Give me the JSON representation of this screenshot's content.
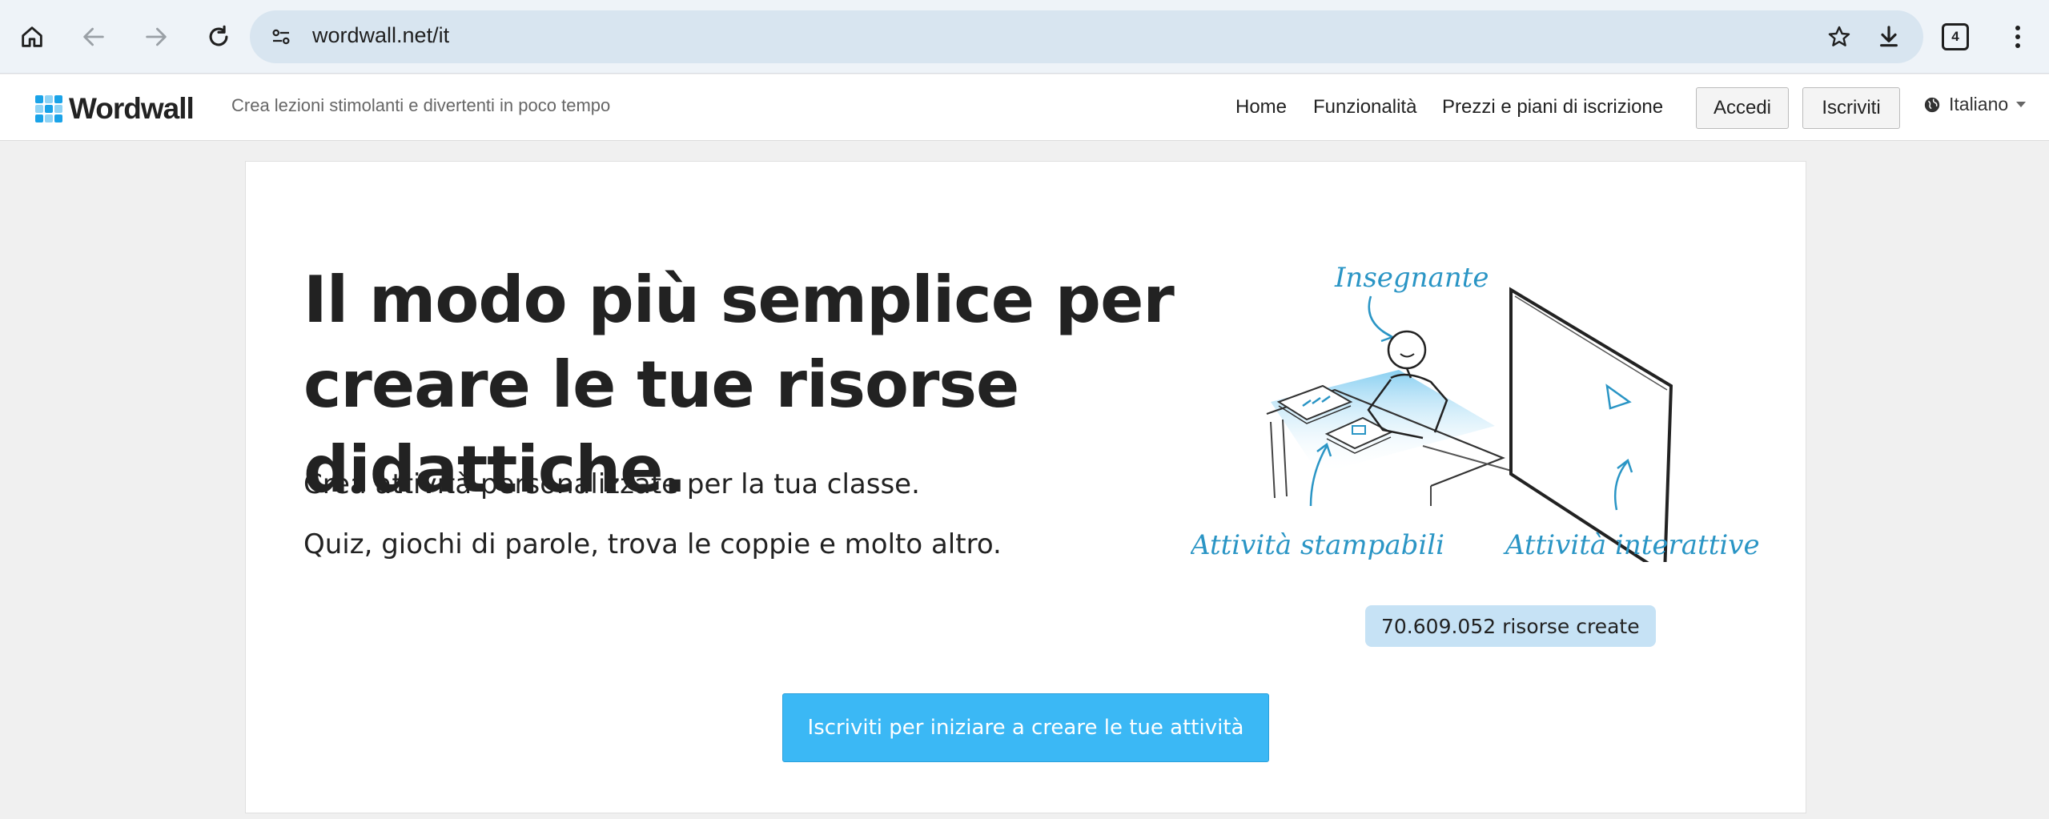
{
  "browser": {
    "url": "wordwall.net/it",
    "tab_count": "4",
    "icons": [
      "home-icon",
      "back-icon",
      "forward-icon",
      "reload-icon",
      "site-info-icon",
      "star-icon",
      "download-icon",
      "tab-count-icon",
      "more-menu-icon"
    ]
  },
  "header": {
    "logo_text": "Wordwall",
    "tagline": "Crea lezioni stimolanti e divertenti in poco tempo",
    "nav": {
      "home": "Home",
      "features": "Funzionalità",
      "pricing": "Prezzi e piani di iscrizione"
    },
    "login": "Accedi",
    "signup": "Iscriviti",
    "language": "Italiano"
  },
  "hero": {
    "headline_line1": "Il modo più semplice per",
    "headline_line2": "creare le tue risorse didattiche.",
    "sub1": "Crea attività personalizzate per la tua classe.",
    "sub2": "Quiz, giochi di parole, trova le coppie e molto altro.",
    "illustration": {
      "label_teacher": "Insegnante",
      "label_printable": "Attività stampabili",
      "label_interactive": "Attività interattive"
    },
    "counter": "70.609.052 risorse create",
    "cta": "Iscriviti per iniziare a creare le tue attività"
  },
  "colors": {
    "accent": "#3bb8f5",
    "counter_bg": "#c6e2f5",
    "illustration_blue": "#2a95c5"
  }
}
